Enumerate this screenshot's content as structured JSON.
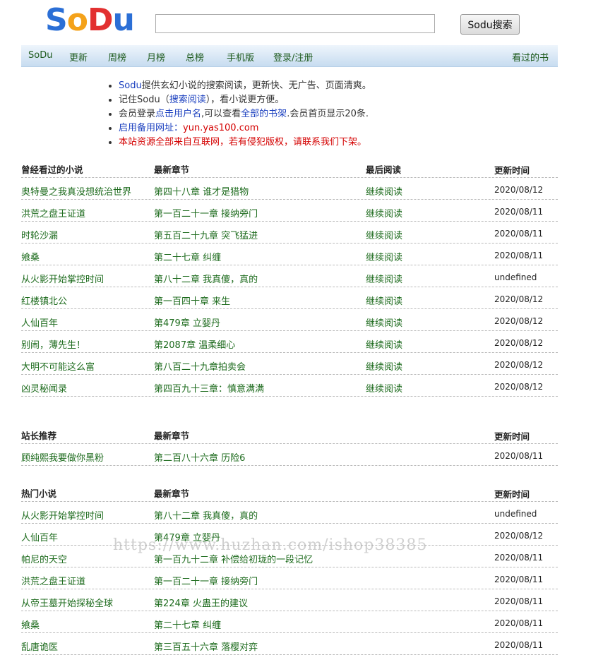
{
  "logo": {
    "letters": [
      "S",
      "o",
      "D",
      "u"
    ]
  },
  "search": {
    "value": "",
    "placeholder": "",
    "button_label": "Sodu搜索"
  },
  "nav": {
    "items": [
      "SoDu",
      "更新",
      "周榜",
      "月榜",
      "总榜",
      "手机版",
      "登录/注册"
    ],
    "right": "看过的书"
  },
  "notice": {
    "line1_link": "Sodu",
    "line1_rest": "提供玄幻小说的搜索阅读，更新快、无广告、页面清爽。",
    "line2_a": "记住Sodu（",
    "line2_link": "搜索阅读",
    "line2_b": "），看小说更方便。",
    "line3_a": "会员登录",
    "line3_link1": "点击用户名",
    "line3_b": ",可以查看",
    "line3_link2": "全部的书架",
    "line3_c": ".会员首页显示20条.",
    "line4_a": "启用备用网址：",
    "line4_url": "yun.yas100.com",
    "line5": "本站资源全部来自互联网，若有侵犯版权，请联系我们下架。"
  },
  "history": {
    "headers": [
      "曾经看过的小说",
      "最新章节",
      "最后阅读",
      "更新时间"
    ],
    "rows": [
      {
        "title": "奥特曼之我真没想统治世界",
        "chapter": "第四十八章 谁才是猎物",
        "action": "继续阅读",
        "time": "2020/08/12"
      },
      {
        "title": "洪荒之盘王证道",
        "chapter": "第一百二十一章 接纳旁门",
        "action": "继续阅读",
        "time": "2020/08/11"
      },
      {
        "title": "时轮沙漏",
        "chapter": "第五百二十九章 突飞猛进",
        "action": "继续阅读",
        "time": "2020/08/11"
      },
      {
        "title": "飨桑",
        "chapter": "第二十七章 纠缠",
        "action": "继续阅读",
        "time": "2020/08/11"
      },
      {
        "title": "从火影开始掌控时间",
        "chapter": "第八十二章 我真傻，真的",
        "action": "继续阅读",
        "time": "undefined"
      },
      {
        "title": "红楼镇北公",
        "chapter": "第一百四十章 来生",
        "action": "继续阅读",
        "time": "2020/08/12"
      },
      {
        "title": "人仙百年",
        "chapter": "第479章 立婴丹",
        "action": "继续阅读",
        "time": "2020/08/12"
      },
      {
        "title": "别闹，薄先生！",
        "chapter": "第2087章 温柔细心",
        "action": "继续阅读",
        "time": "2020/08/12"
      },
      {
        "title": "大明不可能这么富",
        "chapter": "第八百二十九章拍卖会",
        "action": "继续阅读",
        "time": "2020/08/12"
      },
      {
        "title": "凶灵秘闻录",
        "chapter": "第四百九十三章：慎意满满",
        "action": "继续阅读",
        "time": "2020/08/12"
      }
    ]
  },
  "recommend": {
    "headers": [
      "站长推荐",
      "最新章节",
      "",
      "更新时间"
    ],
    "rows": [
      {
        "title": "顾纯熙我要做你黑粉",
        "chapter": "第二百八十六章 历险6",
        "time": "2020/08/11"
      }
    ]
  },
  "hot": {
    "headers": [
      "热门小说",
      "最新章节",
      "",
      "更新时间"
    ],
    "rows": [
      {
        "title": "从火影开始掌控时间",
        "chapter": "第八十二章 我真傻，真的",
        "time": "undefined"
      },
      {
        "title": "人仙百年",
        "chapter": "第479章 立婴丹",
        "time": "2020/08/12"
      },
      {
        "title": "帕尼的天空",
        "chapter": "第一百九十二章 补偿给初珑的一段记忆",
        "time": "2020/08/11"
      },
      {
        "title": "洪荒之盘王证道",
        "chapter": "第一百二十一章 接纳旁门",
        "time": "2020/08/11"
      },
      {
        "title": "从帝王墓开始探秘全球",
        "chapter": "第224章 火蛊王的建议",
        "time": "2020/08/11"
      },
      {
        "title": "飨桑",
        "chapter": "第二十七章 纠缠",
        "time": "2020/08/11"
      },
      {
        "title": "乱唐诡医",
        "chapter": "第三百五十六章 落樱对弈",
        "time": "2020/08/11"
      }
    ]
  },
  "watermark": "https://www.huzhan.com/ishop38385"
}
